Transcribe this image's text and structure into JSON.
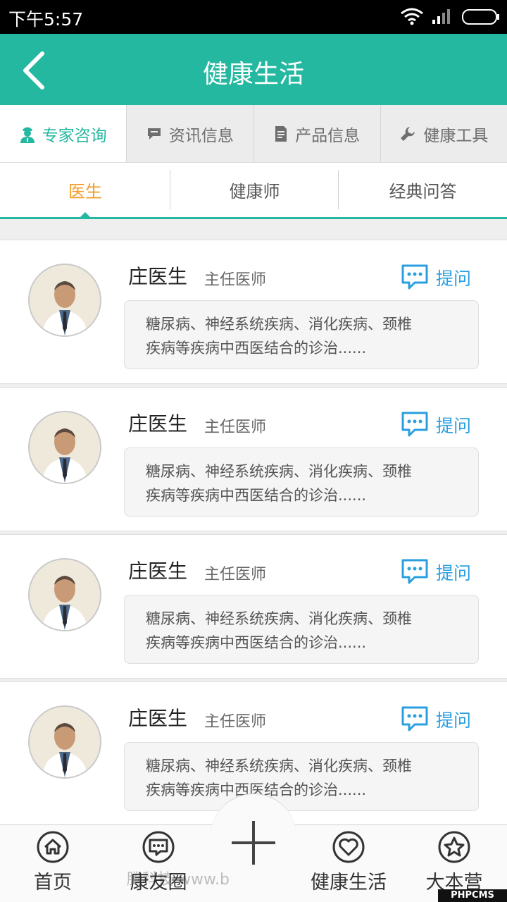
{
  "status_bar": {
    "time": "下午5:57"
  },
  "header": {
    "title": "健康生活"
  },
  "category_tabs": [
    {
      "label": "专家咨询",
      "icon": "doctor-icon",
      "active": true
    },
    {
      "label": "资讯信息",
      "icon": "chat-bubble-icon",
      "active": false
    },
    {
      "label": "产品信息",
      "icon": "document-icon",
      "active": false
    },
    {
      "label": "健康工具",
      "icon": "wrench-icon",
      "active": false
    }
  ],
  "sub_tabs": [
    {
      "label": "医生",
      "active": true
    },
    {
      "label": "健康师",
      "active": false
    },
    {
      "label": "经典问答",
      "active": false
    }
  ],
  "doctors": [
    {
      "name": "庄医生",
      "title": "主任医师",
      "ask_label": "提问",
      "desc_line1": "糖尿病、神经系统疾病、消化疾病、颈椎",
      "desc_line2": "疾病等疾病中西医结合的诊治......"
    },
    {
      "name": "庄医生",
      "title": "主任医师",
      "ask_label": "提问",
      "desc_line1": "糖尿病、神经系统疾病、消化疾病、颈椎",
      "desc_line2": "疾病等疾病中西医结合的诊治......"
    },
    {
      "name": "庄医生",
      "title": "主任医师",
      "ask_label": "提问",
      "desc_line1": "糖尿病、神经系统疾病、消化疾病、颈椎",
      "desc_line2": "疾病等疾病中西医结合的诊治......"
    },
    {
      "name": "庄医生",
      "title": "主任医师",
      "ask_label": "提问",
      "desc_line1": "糖尿病、神经系统疾病、消化疾病、颈椎",
      "desc_line2": "疾病等疾病中西医结合的诊治......"
    }
  ],
  "bottom_nav": [
    {
      "label": "首页",
      "icon": "home-icon"
    },
    {
      "label": "康友圈",
      "icon": "message-icon"
    },
    {
      "label": "健康生活",
      "icon": "heart-icon"
    },
    {
      "label": "大本营",
      "icon": "star-icon"
    }
  ],
  "watermark": "腾科技 www.b",
  "corner_badge": "PHPCMS",
  "colors": {
    "primary": "#25b8a1",
    "active_subtab": "#f39c28",
    "ask": "#2a9fe0"
  }
}
